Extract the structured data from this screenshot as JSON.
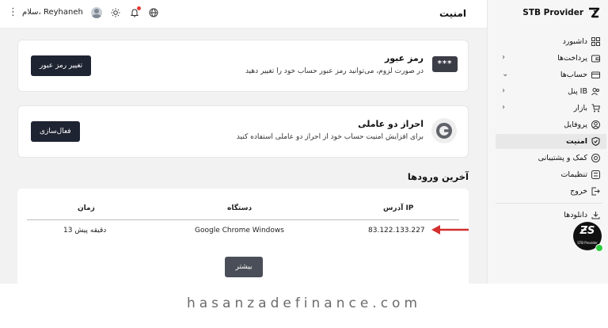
{
  "header": {
    "page_title": "امنیت",
    "greeting": "سلام، Reyhaneh",
    "more_icon": "more-vertical-icon",
    "user_icon": "user-avatar-icon",
    "theme_icon": "sun-icon",
    "notification_icon": "bell-icon",
    "language_icon": "globe-icon"
  },
  "cards": {
    "password": {
      "badge": "***",
      "title": "رمز عبور",
      "description": "در صورت لزوم، می‌توانید رمز عبور حساب خود را تغییر دهید",
      "button_label": "تغییر رمز عبور"
    },
    "two_factor": {
      "icon": "google-authenticator-icon",
      "title": "احراز دو عاملی",
      "description": "برای افزایش امنیت حساب خود از احراز دو عاملی استفاده کنید",
      "button_label": "فعال‌سازی"
    }
  },
  "logins": {
    "title": "آخرین ورودها",
    "columns": {
      "ip": "آدرس IP",
      "device": "دستگاه",
      "time": "زمان"
    },
    "rows": [
      {
        "ip": "83.122.133.227",
        "device": "Google Chrome  Windows",
        "time": "13 دقیقه پیش"
      }
    ],
    "more_label": "بیشتر",
    "arrow_icon": "red-arrow-left-icon"
  },
  "sidebar": {
    "brand": "STB Provider",
    "items": [
      {
        "label": "داشبورد",
        "icon": "grid-icon"
      },
      {
        "label": "پرداخت‌ها",
        "icon": "wallet-icon",
        "chevron": "›"
      },
      {
        "label": "حساب‌ها",
        "icon": "card-icon",
        "chevron": "⌄"
      },
      {
        "label": "پنل IB",
        "icon": "users-icon",
        "chevron": "›"
      },
      {
        "label": "بازار",
        "icon": "cart-icon",
        "chevron": "›"
      },
      {
        "label": "پروفایل",
        "icon": "user-circle-icon"
      },
      {
        "label": "امنیت",
        "icon": "shield-icon"
      },
      {
        "label": "کمک و پشتیبانی",
        "icon": "help-icon"
      },
      {
        "label": "تنظیمات",
        "icon": "settings-icon"
      },
      {
        "label": "خروج",
        "icon": "logout-icon"
      },
      {
        "label": "دانلودها",
        "icon": "download-icon"
      }
    ],
    "logo_mark": "ƵЅ",
    "logo_sub": "STB Provider"
  },
  "watermark": "hasanzadefinance.com",
  "colors": {
    "dark_button": "#1f2433",
    "arrow": "#d32f2f",
    "online": "#2ecc40"
  }
}
